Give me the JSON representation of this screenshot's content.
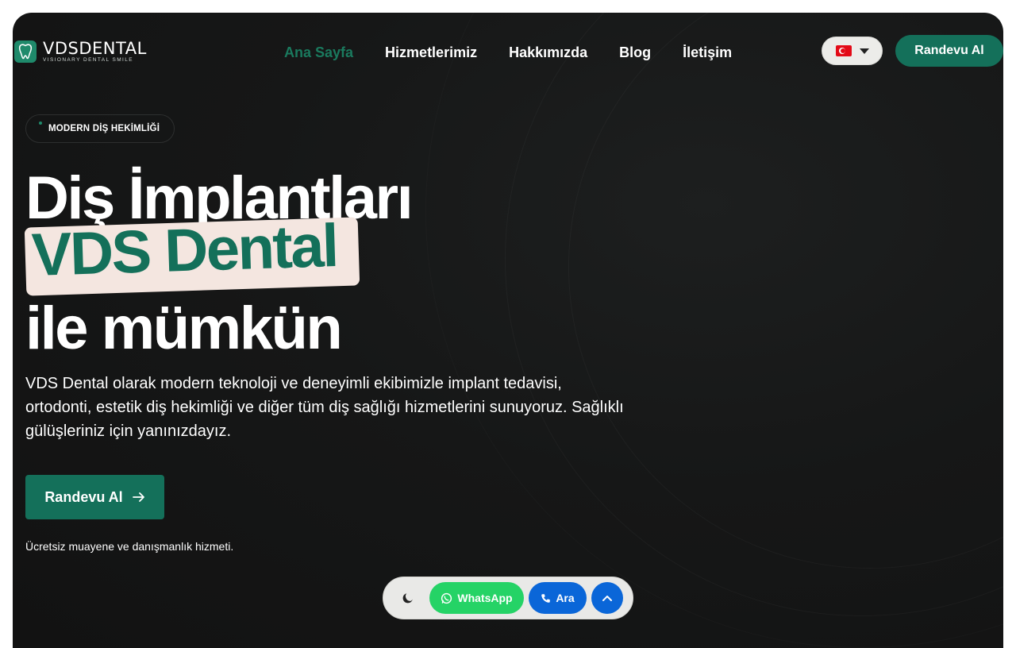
{
  "brand": {
    "name": "VDSDENTAL",
    "tagline": "VISIONARY DENTAL SMILE",
    "logo_icon": "tooth-icon",
    "accent_color": "#14705a"
  },
  "nav": {
    "items": [
      {
        "label": "Ana Sayfa",
        "active": true
      },
      {
        "label": "Hizmetlerimiz",
        "active": false
      },
      {
        "label": "Hakkımızda",
        "active": false
      },
      {
        "label": "Blog",
        "active": false
      },
      {
        "label": "İletişim",
        "active": false
      }
    ]
  },
  "header": {
    "language_icon": "turkey-flag-icon",
    "cta_label": "Randevu Al"
  },
  "hero": {
    "badge": "MODERN DİŞ HEKİMLİĞİ",
    "title_line1": "Diş İmplantları",
    "title_highlight": "VDS Dental",
    "title_line3": "ile mümkün",
    "description": "VDS Dental olarak modern teknoloji ve deneyimli ekibimizle implant tedavisi, ortodonti, estetik diş hekimliği ve diğer tüm diş sağlığı hizmetlerini sunuyoruz. Sağlıklı gülüşleriniz için yanınızdayız.",
    "cta_label": "Randevu Al",
    "note": "Ücretsiz muayene ve danışmanlık hizmeti."
  },
  "floating_bar": {
    "theme_icon": "moon-icon",
    "whatsapp_label": "WhatsApp",
    "whatsapp_color": "#25d366",
    "call_label": "Ara",
    "call_color": "#0a66d8",
    "scroll_top_icon": "chevron-up-icon"
  }
}
